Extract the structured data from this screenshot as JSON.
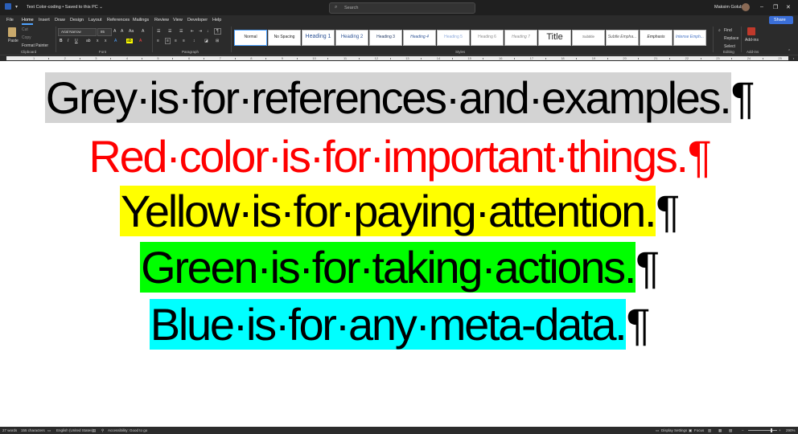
{
  "titlebar": {
    "doc_title": "Text Color-coding • Saved to this PC ⌄",
    "search_placeholder": "Search",
    "user_name": "Maksim Golub",
    "minimize": "–",
    "restore": "❐",
    "close": "✕"
  },
  "menu": {
    "tabs": [
      "File",
      "Home",
      "Insert",
      "Draw",
      "Design",
      "Layout",
      "References",
      "Mailings",
      "Review",
      "View",
      "Developer",
      "Help"
    ],
    "active_tab": "Home",
    "share_label": "Share"
  },
  "ribbon": {
    "clipboard": {
      "paste": "Paste",
      "cut": "Cut",
      "copy": "Copy",
      "format_painter": "Format Painter",
      "label": "Clipboard"
    },
    "font": {
      "font_name": "Arial Narrow",
      "font_size": "85",
      "label": "Font"
    },
    "paragraph": {
      "label": "Paragraph"
    },
    "styles": {
      "label": "Styles",
      "items": [
        "Normal",
        "No Spacing",
        "Heading 1",
        "Heading 2",
        "Heading 3",
        "Heading 4",
        "Heading 5",
        "Heading 6",
        "Heading 7",
        "Title",
        "Subtitle",
        "Subtle Empha...",
        "Emphasis",
        "Intense Emph..."
      ]
    },
    "editing": {
      "find": "Find",
      "replace": "Replace",
      "select": "Select",
      "label": "Editing"
    },
    "addins": {
      "button": "Add-ins",
      "label": "Add-ins"
    }
  },
  "ruler": {
    "numbers": [
      "1",
      "2",
      "3",
      "4",
      "5",
      "6",
      "7",
      "8",
      "9",
      "10",
      "11",
      "12",
      "13",
      "14",
      "15",
      "16",
      "17",
      "18",
      "19",
      "20",
      "21",
      "22",
      "23",
      "24",
      "25"
    ]
  },
  "document": {
    "pilcrow": "¶",
    "lines": [
      {
        "text": "Grey·is·for·references·and·examples.",
        "color": "#000000",
        "highlight": "#d3d3d3"
      },
      {
        "text": "Red·color·is·for·important·things.",
        "color": "#ff0000",
        "highlight": ""
      },
      {
        "text": "Yellow·is·for·paying·attention.",
        "color": "#000000",
        "highlight": "#ffff00"
      },
      {
        "text": "Green·is·for·taking·actions.",
        "color": "#000000",
        "highlight": "#00ff00"
      },
      {
        "text": "Blue·is·for·any·meta-data.",
        "color": "#000000",
        "highlight": "#00ffff"
      }
    ]
  },
  "statusbar": {
    "words": "27 words",
    "characters": "155 characters",
    "language": "English (United States)",
    "accessibility": "Accessibility: Good to go",
    "display_settings": "Display Settings",
    "focus": "Focus",
    "zoom": "290%"
  },
  "colors": {
    "chrome_dark": "#1f1f1f",
    "ribbon": "#2b2b2b",
    "accent": "#3b6fd8"
  },
  "icons": [
    "word-icon",
    "save-icon",
    "undo-icon",
    "search-icon",
    "paste-icon",
    "find-icon",
    "addins-icon",
    "focus-icon"
  ]
}
